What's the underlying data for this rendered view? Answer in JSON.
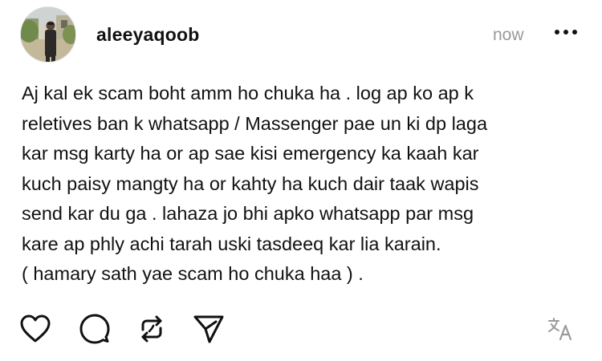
{
  "post": {
    "author": "aleeyaqoob",
    "timestamp": "now",
    "body": "Aj  kal ek scam boht  amm ho chuka ha . log ap ko ap k\nreletives ban k whatsapp / Massenger pae un ki dp laga\nkar msg karty ha or ap sae kisi emergency ka kaah kar\nkuch paisy mangty ha or kahty ha kuch dair taak wapis\nsend kar du ga . lahaza jo bhi apko whatsapp par msg\nkare ap phly achi tarah uski tasdeeq kar lia karain.\n( hamary sath yae scam ho chuka haa ) ."
  },
  "icons": {
    "more": "more-horizontal-icon",
    "like": "heart-icon",
    "reply": "comment-icon",
    "repost": "repost-icon",
    "share": "send-icon",
    "translate": "translate-icon"
  },
  "colors": {
    "text": "#111111",
    "muted": "#9a9a9a",
    "background": "#ffffff"
  }
}
